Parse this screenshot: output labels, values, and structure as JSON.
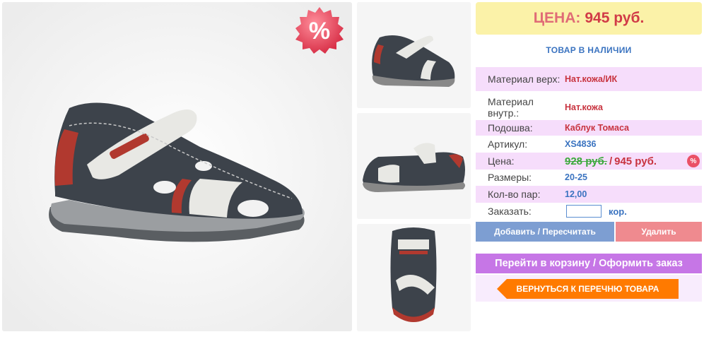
{
  "badge": {
    "symbol": "%"
  },
  "price": {
    "label": "ЦЕНА:",
    "value": "945 руб."
  },
  "stock": "ТОВАР В НАЛИЧИИ",
  "specs": [
    {
      "label": "Материал верх:",
      "value": "Нат.кожа/ИК"
    },
    {
      "label": "Материал внутр.:",
      "value": "Нат.кожа"
    },
    {
      "label": "Подошва:",
      "value": "Каблук Томаса"
    },
    {
      "label": "Артикул:",
      "value": "XS4836"
    }
  ],
  "price_row": {
    "label": "Цена:",
    "old": "928 руб.",
    "sep": "/",
    "new": "945 руб.",
    "badge": "%"
  },
  "sizes": {
    "label": "Размеры:",
    "value": "20-25"
  },
  "pairs": {
    "label": "Кол-во пар:",
    "value": "12,00"
  },
  "order": {
    "label": "Заказать:",
    "value": "",
    "unit": "кор."
  },
  "buttons": {
    "add": "Добавить / Пересчитать",
    "delete": "Удалить",
    "cart": "Перейти в корзину / Оформить заказ",
    "back": "ВЕРНУТЬСЯ К ПЕРЕЧНЮ ТОВАРА"
  },
  "colors": {
    "price_bg": "#fbf2a8",
    "pink_row": "#f6ddfb",
    "accent_blue": "#3a73c0",
    "accent_red": "#c8333f",
    "cart_purple": "#c676e6",
    "back_orange": "#ff7a00"
  }
}
